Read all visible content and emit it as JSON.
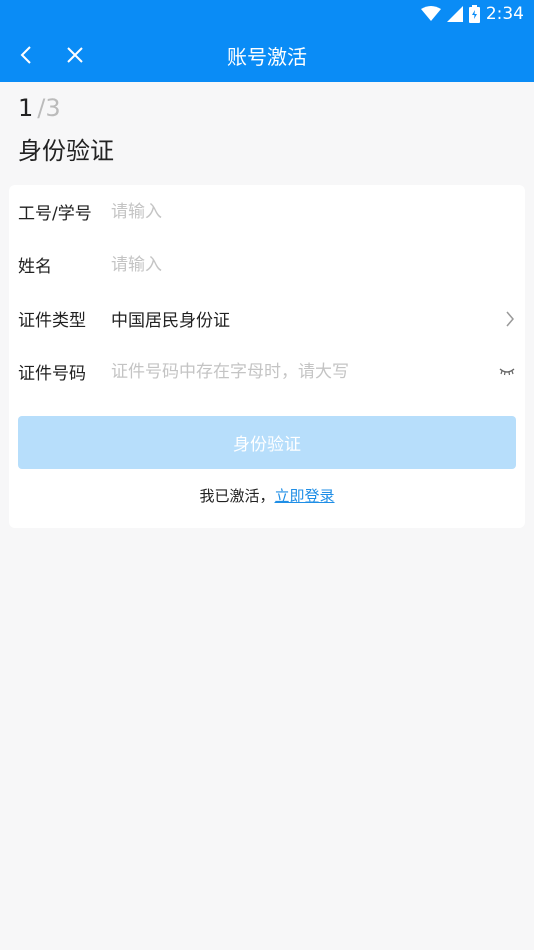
{
  "status_bar": {
    "time": "2:34"
  },
  "app_bar": {
    "title": "账号激活"
  },
  "step": {
    "current": "1",
    "total": "/3"
  },
  "section_title": "身份验证",
  "form": {
    "rows": [
      {
        "label": "工号/学号",
        "placeholder": "请输入",
        "value": ""
      },
      {
        "label": "姓名",
        "placeholder": "请输入",
        "value": ""
      },
      {
        "label": "证件类型",
        "value": "中国居民身份证"
      },
      {
        "label": "证件号码",
        "placeholder": "证件号码中存在字母时，请大写",
        "value": ""
      }
    ],
    "submit_label": "身份验证"
  },
  "footer": {
    "prefix": "我已激活，",
    "link": "立即登录"
  },
  "colors": {
    "primary": "#0a8cf6",
    "button_disabled": "#b7defb",
    "link": "#1f8ee6",
    "placeholder": "#c4c4c4"
  }
}
